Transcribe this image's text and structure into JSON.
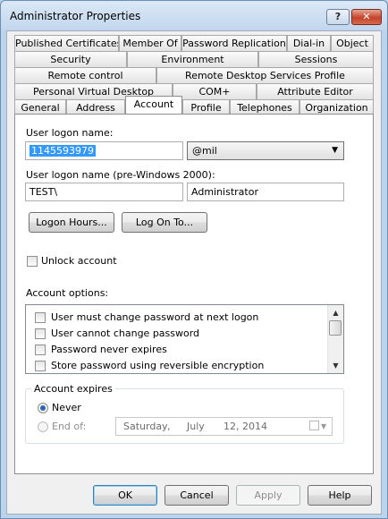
{
  "window": {
    "title": "Administrator Properties",
    "help_glyph": "?",
    "close_glyph": "✕"
  },
  "tabs": {
    "row1": [
      "Published Certificates",
      "Member Of",
      "Password Replication",
      "Dial-in",
      "Object"
    ],
    "row2": [
      "Security",
      "Environment",
      "Sessions"
    ],
    "row3": [
      "Remote control",
      "Remote Desktop Services Profile"
    ],
    "row4": [
      "Personal Virtual Desktop",
      "COM+",
      "Attribute Editor"
    ],
    "row5": [
      "General",
      "Address",
      "Account",
      "Profile",
      "Telephones",
      "Organization"
    ],
    "active": "Account"
  },
  "account": {
    "logon_label": "User logon name:",
    "logon_value": "1145593979",
    "domain_value": "@mil",
    "pre2000_label": "User logon name (pre-Windows 2000):",
    "pre2000_domain": "TEST\\",
    "pre2000_user": "Administrator",
    "logon_hours_button": "Logon Hours...",
    "log_on_to_button": "Log On To...",
    "unlock_label": "Unlock account",
    "options_label": "Account options:",
    "options": [
      "User must change password at next logon",
      "User cannot change password",
      "Password never expires",
      "Store password using reversible encryption"
    ],
    "expires_label": "Account expires",
    "never_label": "Never",
    "end_of_label": "End of:",
    "date": {
      "weekday": "Saturday",
      "sep": ",",
      "month": "July",
      "daynum": "12, 2014"
    }
  },
  "buttons": {
    "ok": "OK",
    "cancel": "Cancel",
    "apply": "Apply",
    "help": "Help"
  }
}
